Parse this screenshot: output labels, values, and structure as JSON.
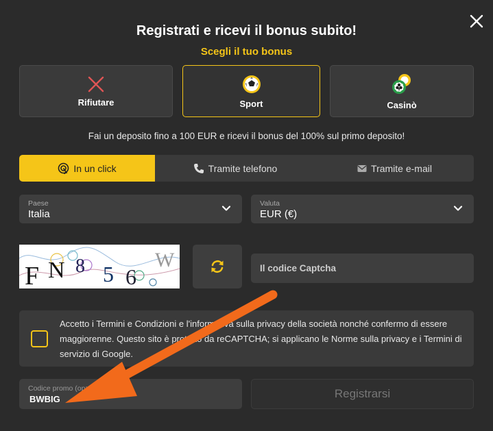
{
  "modal": {
    "title": "Registrati e ricevi il bonus subito!",
    "subtitle": "Scegli il tuo bonus"
  },
  "bonus_options": [
    {
      "label": "Rifiutare",
      "icon": "x-icon",
      "selected": false
    },
    {
      "label": "Sport",
      "icon": "soccer-ball-icon",
      "selected": true
    },
    {
      "label": "Casinò",
      "icon": "casino-chips-icon",
      "selected": false
    }
  ],
  "info_text": "Fai un deposito fino a 100 EUR e ricevi il bonus del 100% sul primo deposito!",
  "tabs": [
    {
      "label": "In un click",
      "icon": "one-click-icon",
      "active": true
    },
    {
      "label": "Tramite telefono",
      "icon": "phone-icon",
      "active": false
    },
    {
      "label": "Tramite e-mail",
      "icon": "envelope-icon",
      "active": false
    }
  ],
  "country": {
    "label": "Paese",
    "value": "Italia"
  },
  "currency": {
    "label": "Valuta",
    "value": "EUR (€)"
  },
  "captcha": {
    "placeholder": "Il codice Captcha",
    "image_text": "FN856W"
  },
  "terms_text": "Accetto i Termini e Condizioni e l'informativa sulla privacy della società nonché confermo di essere maggiorenne. Questo sito è protetto da reCAPTCHA; si applicano le Norme sulla privacy e i Termini di servizio di Google.",
  "promo": {
    "label": "Codice promo (opzionale)",
    "value": "BWBIG"
  },
  "register_label": "Registrarsi",
  "colors": {
    "accent": "#f5c518",
    "background": "#2b2b2b",
    "arrow": "#f26a1b"
  }
}
